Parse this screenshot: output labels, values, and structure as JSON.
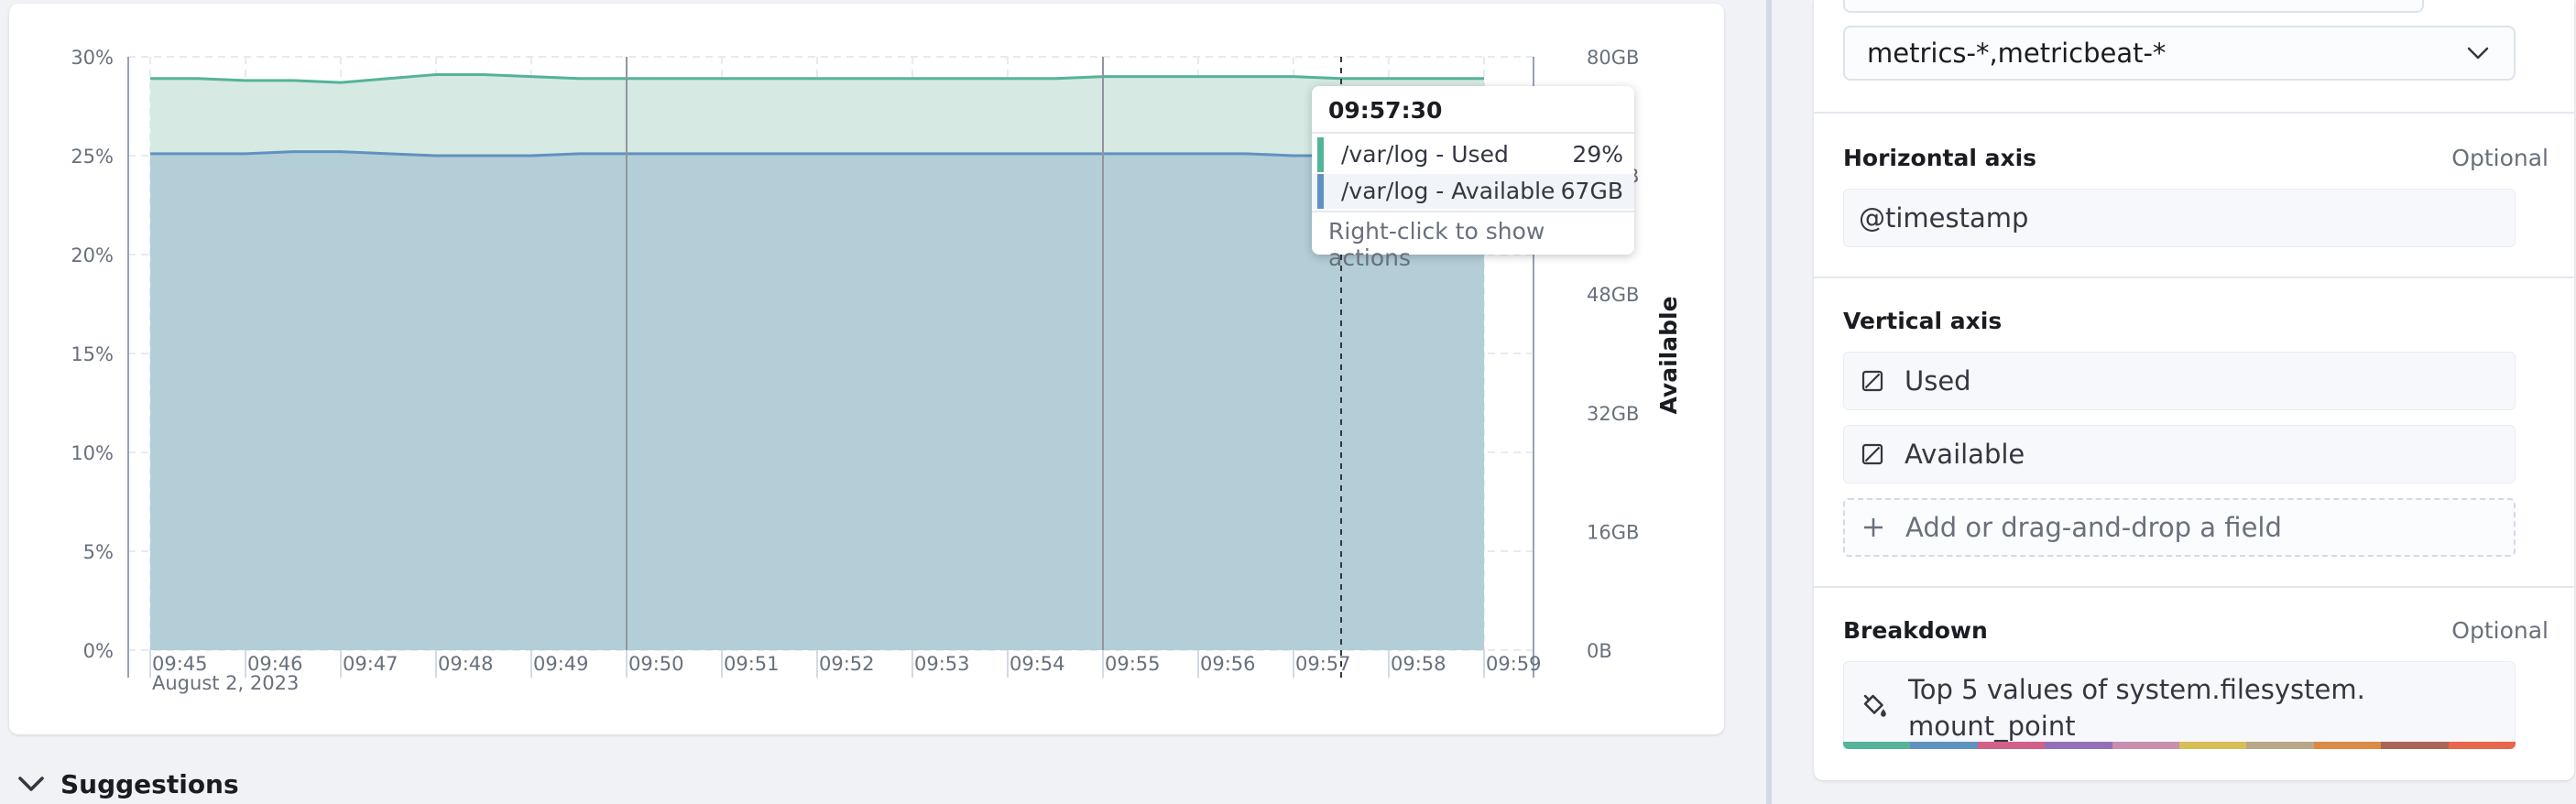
{
  "chart_data": {
    "type": "area",
    "stacked": true,
    "x": [
      "09:45",
      "09:45:30",
      "09:46",
      "09:46:30",
      "09:47",
      "09:47:30",
      "09:48",
      "09:48:30",
      "09:49",
      "09:49:30",
      "09:50",
      "09:50:30",
      "09:51",
      "09:51:30",
      "09:52",
      "09:52:30",
      "09:53",
      "09:53:30",
      "09:54",
      "09:54:30",
      "09:55",
      "09:55:30",
      "09:56",
      "09:56:30",
      "09:57",
      "09:57:30",
      "09:58",
      "09:58:30",
      "09:59"
    ],
    "x_tick_labels": [
      "09:45",
      "09:46",
      "09:47",
      "09:48",
      "09:49",
      "09:50",
      "09:51",
      "09:52",
      "09:53",
      "09:54",
      "09:55",
      "09:56",
      "09:57",
      "09:58",
      "09:59"
    ],
    "x_date_label": "August 2, 2023",
    "y_left": {
      "ticks": [
        "0%",
        "5%",
        "10%",
        "15%",
        "20%",
        "25%",
        "30%"
      ],
      "range": [
        0,
        30
      ]
    },
    "y_right": {
      "ticks": [
        "0B",
        "16GB",
        "32GB",
        "48GB",
        "64GB",
        "80GB"
      ],
      "range": [
        0,
        80
      ],
      "label": "Available"
    },
    "series": [
      {
        "name": "/var/log - Used",
        "color": "#6092c0",
        "values": [
          25.1,
          25.1,
          25.1,
          25.2,
          25.2,
          25.1,
          25.0,
          25.0,
          25.0,
          25.1,
          25.1,
          25.1,
          25.1,
          25.1,
          25.1,
          25.1,
          25.1,
          25.1,
          25.1,
          25.1,
          25.1,
          25.1,
          25.1,
          25.1,
          25.0,
          25.0,
          25.0,
          25.0,
          25.0
        ]
      },
      {
        "name": "/var/log - Available",
        "color": "#54b399",
        "values": [
          28.9,
          28.9,
          28.8,
          28.8,
          28.7,
          28.9,
          29.1,
          29.1,
          29.0,
          28.9,
          28.9,
          28.9,
          28.9,
          28.9,
          28.9,
          28.9,
          28.9,
          28.9,
          28.9,
          28.9,
          29.0,
          29.0,
          29.0,
          29.0,
          29.0,
          28.9,
          28.9,
          28.9,
          28.9
        ]
      }
    ],
    "crosshair_index": 25
  },
  "tooltip": {
    "time": "09:57:30",
    "rows": [
      {
        "label": "/var/log - Used",
        "value": "29%",
        "color": "#54b399"
      },
      {
        "label": "/var/log - Available",
        "value": "67GB",
        "color": "#6092c0"
      }
    ],
    "hint": "Right-click to show actions"
  },
  "suggestions": {
    "label": "Suggestions"
  },
  "config": {
    "index_pattern": "metrics-*,metricbeat-*",
    "horizontal_axis": {
      "title": "Horizontal axis",
      "optional": "Optional",
      "field": "@timestamp"
    },
    "vertical_axis": {
      "title": "Vertical axis",
      "fields": [
        "Used",
        "Available"
      ],
      "add_label": "Add or drag-and-drop a field"
    },
    "breakdown": {
      "title": "Breakdown",
      "optional": "Optional",
      "field": "Top 5 values of system.filesystem. mount_point"
    },
    "palette": [
      "#54b399",
      "#6092c0",
      "#d36086",
      "#9170b8",
      "#ca8eae",
      "#d6bf57",
      "#b9a888",
      "#da8b45",
      "#aa6556",
      "#e7664c"
    ]
  }
}
